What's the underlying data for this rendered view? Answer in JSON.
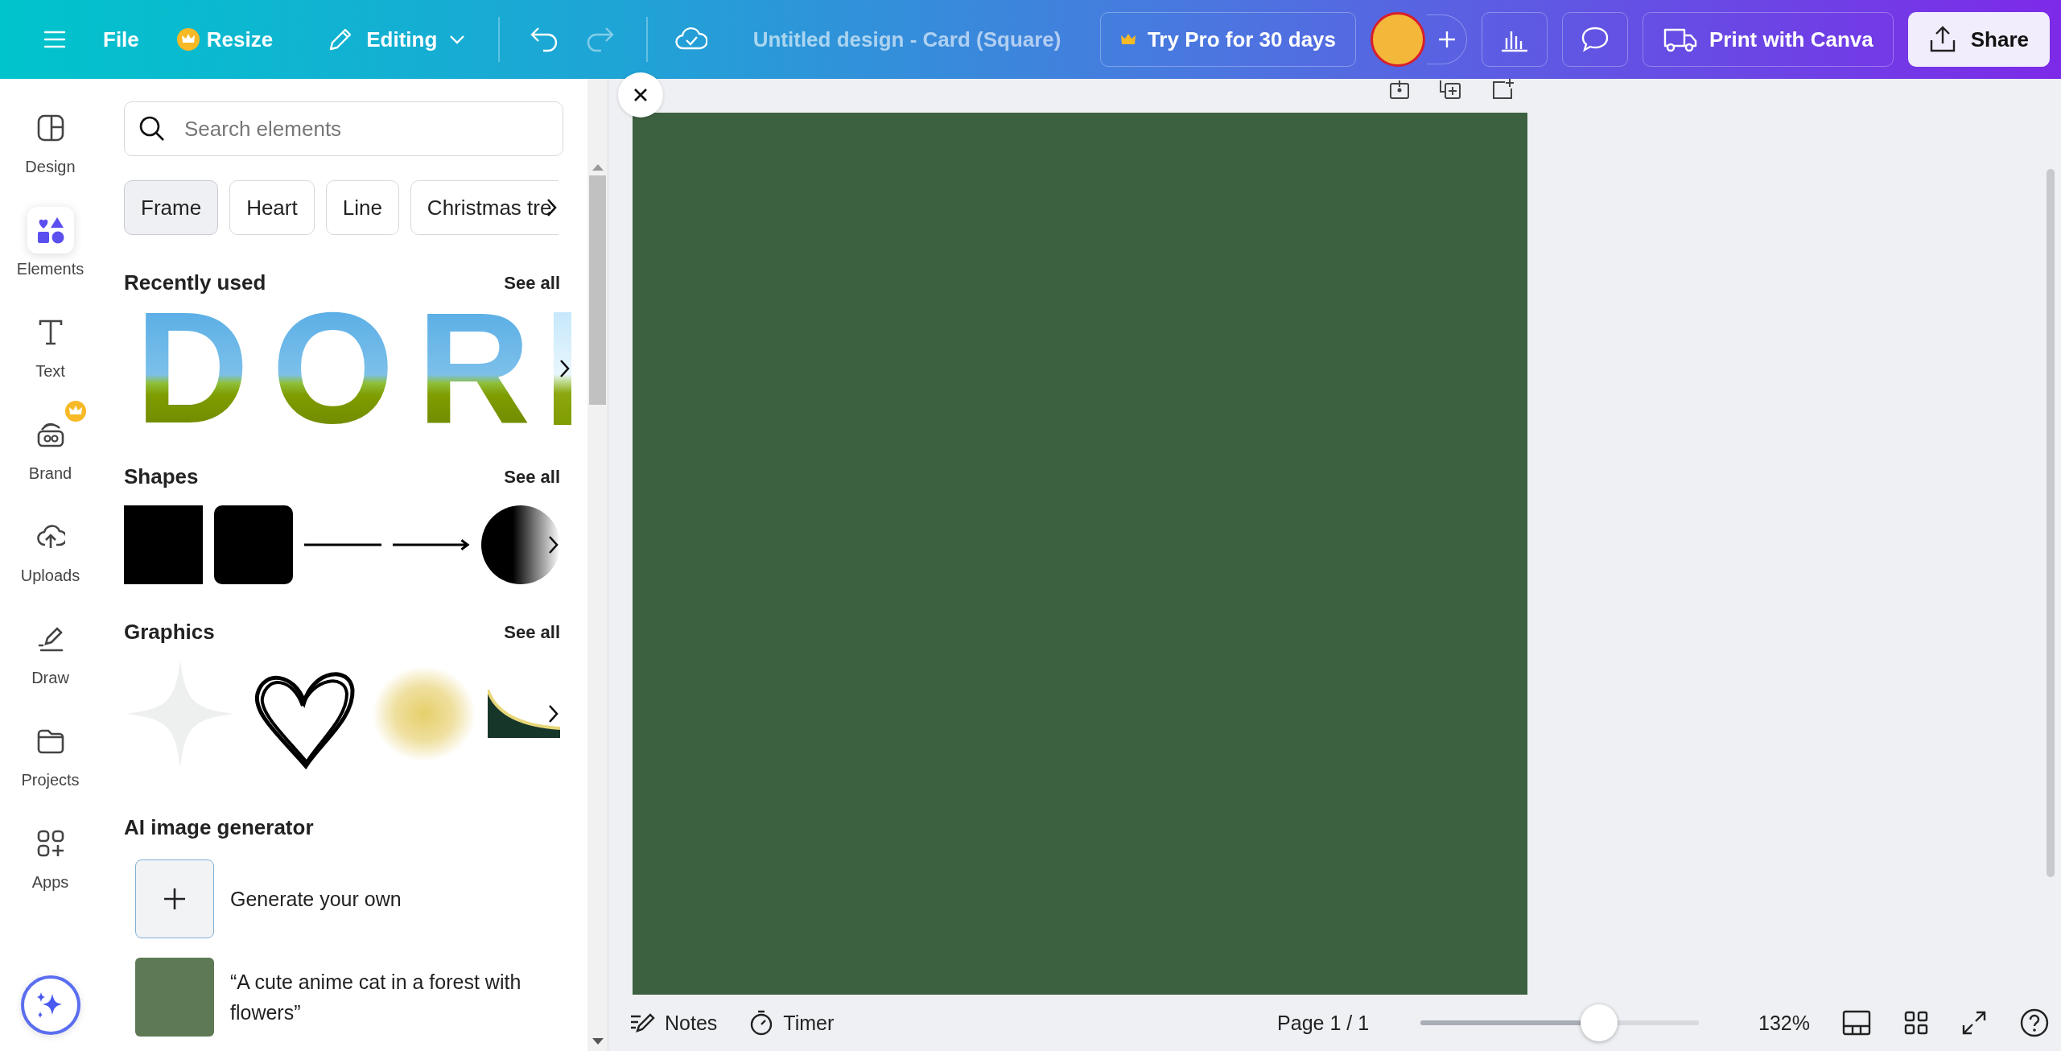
{
  "topbar": {
    "file": "File",
    "resize": "Resize",
    "mode": "Editing",
    "history": [
      {
        "kind": "undo",
        "disabled": false
      },
      {
        "kind": "redo",
        "disabled": true
      }
    ],
    "title": "Untitled design - Card (Square)",
    "pro": "Try Pro for 30 days",
    "print": "Print with Canva",
    "share": "Share"
  },
  "rail": [
    {
      "kind": "design",
      "label": "Design",
      "selected": false,
      "pro": false
    },
    {
      "kind": "elements",
      "label": "Elements",
      "selected": true,
      "pro": false
    },
    {
      "kind": "text",
      "label": "Text",
      "selected": false,
      "pro": false
    },
    {
      "kind": "brand",
      "label": "Brand",
      "selected": false,
      "pro": true
    },
    {
      "kind": "uploads",
      "label": "Uploads",
      "selected": false,
      "pro": false
    },
    {
      "kind": "draw",
      "label": "Draw",
      "selected": false,
      "pro": false
    },
    {
      "kind": "projects",
      "label": "Projects",
      "selected": false,
      "pro": false
    },
    {
      "kind": "apps",
      "label": "Apps",
      "selected": false,
      "pro": false
    }
  ],
  "panel": {
    "search": {
      "placeholder": "Search elements"
    },
    "chips": [
      {
        "label": "Frame",
        "selected": true
      },
      {
        "label": "Heart",
        "selected": false
      },
      {
        "label": "Line",
        "selected": false
      },
      {
        "label": "Christmas tre",
        "selected": false
      }
    ],
    "sections": [
      {
        "kind": "letters",
        "title": "Recently used",
        "link": "See all",
        "letters": [
          "D",
          "O",
          "R"
        ]
      },
      {
        "kind": "shapes",
        "title": "Shapes",
        "link": "See all"
      },
      {
        "kind": "graphics",
        "title": "Graphics",
        "link": "See all"
      }
    ],
    "ai": {
      "title": "AI image generator",
      "items": [
        {
          "kind": "generate",
          "label": "Generate your own"
        },
        {
          "kind": "example",
          "label": "“A cute anime cat in a forest with flowers”"
        }
      ]
    }
  },
  "bottom": {
    "notes": "Notes",
    "timer": "Timer",
    "page": "Page 1 / 1",
    "zoom": {
      "level": 0.64,
      "reading": "132%"
    }
  }
}
